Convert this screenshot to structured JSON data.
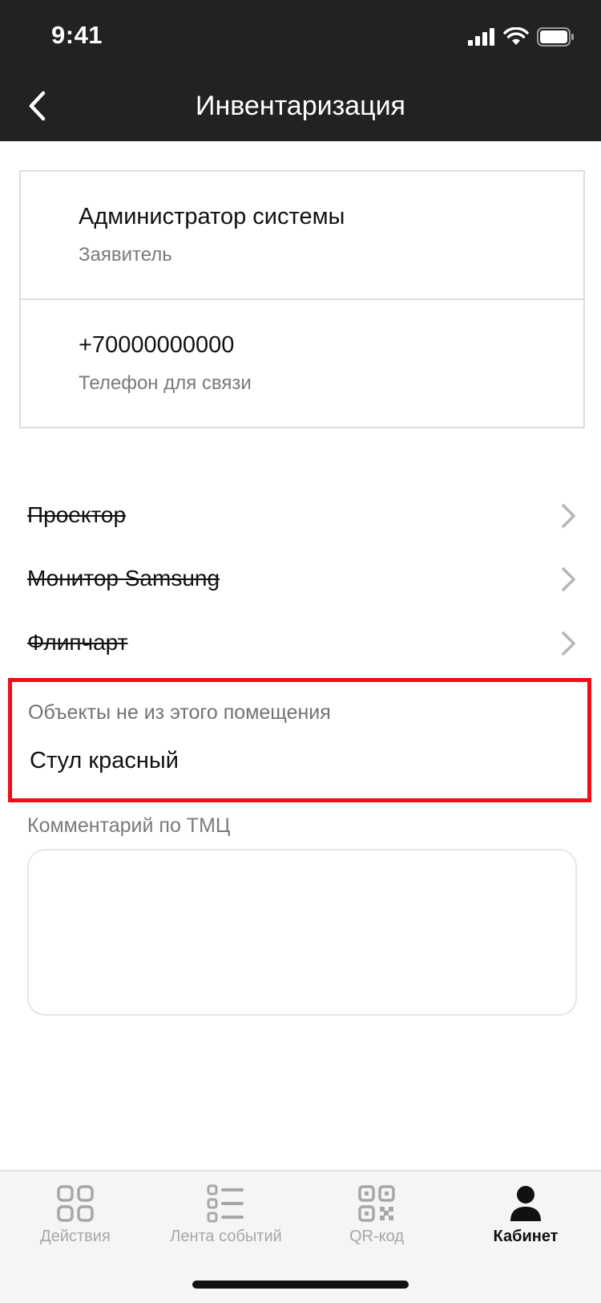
{
  "status_bar": {
    "time": "9:41"
  },
  "header": {
    "title": "Инвентаризация"
  },
  "applicant": {
    "name": "Администратор системы",
    "name_label": "Заявитель",
    "phone": "+70000000000",
    "phone_label": "Телефон для связи"
  },
  "assets": [
    {
      "name": "Проектор"
    },
    {
      "name": "Монитор Samsung"
    },
    {
      "name": "Флипчарт"
    }
  ],
  "foreign_objects": {
    "title": "Объекты не из этого помещения",
    "items": [
      {
        "name": "Стул красный"
      }
    ]
  },
  "comment": {
    "label": "Комментарий по ТМЦ",
    "value": ""
  },
  "tabbar": {
    "tabs": [
      {
        "label": "Действия",
        "icon": "grid-icon",
        "active": false
      },
      {
        "label": "Лента событий",
        "icon": "list-icon",
        "active": false
      },
      {
        "label": "QR-код",
        "icon": "qr-code-icon",
        "active": false
      },
      {
        "label": "Кабинет",
        "icon": "user-icon",
        "active": true
      }
    ]
  },
  "colors": {
    "header_bg": "#222222",
    "highlight_border": "#ef0f16",
    "inactive_tab": "#a7a7a7"
  }
}
